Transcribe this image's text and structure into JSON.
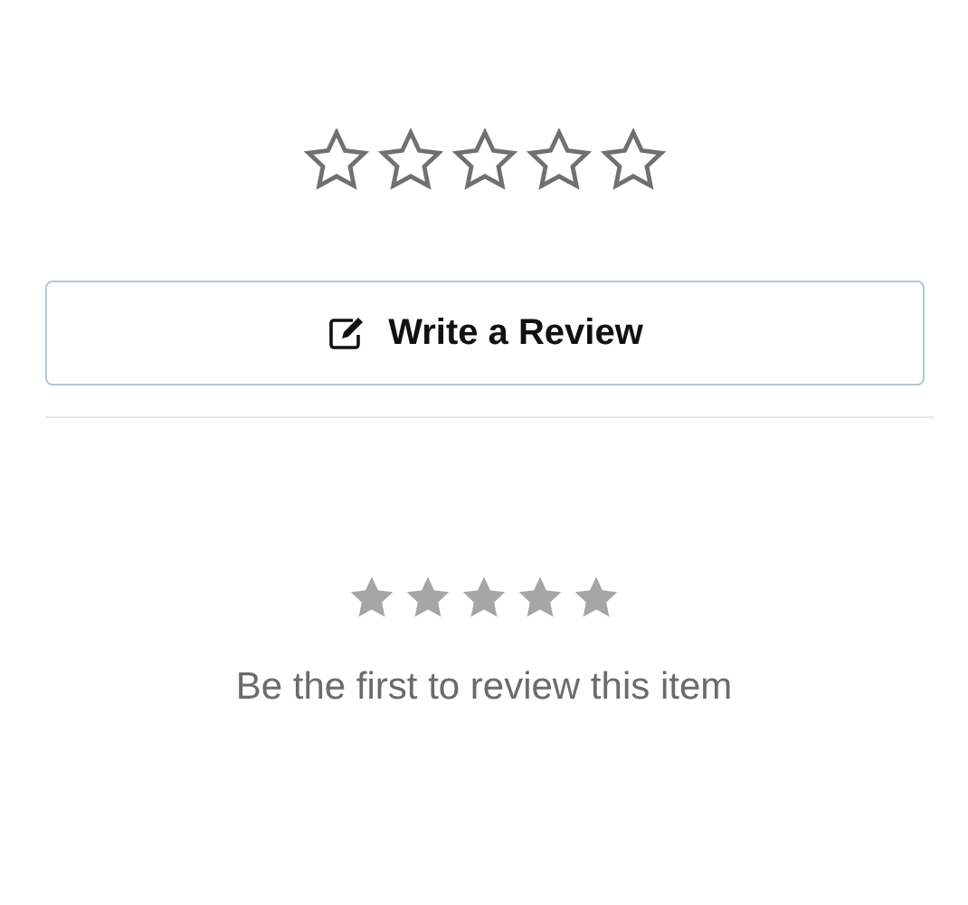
{
  "rating_input": {
    "stars": 0
  },
  "write_review_button": {
    "label": "Write a Review"
  },
  "summary": {
    "stars": 0,
    "message": "Be the first to review this item"
  }
}
